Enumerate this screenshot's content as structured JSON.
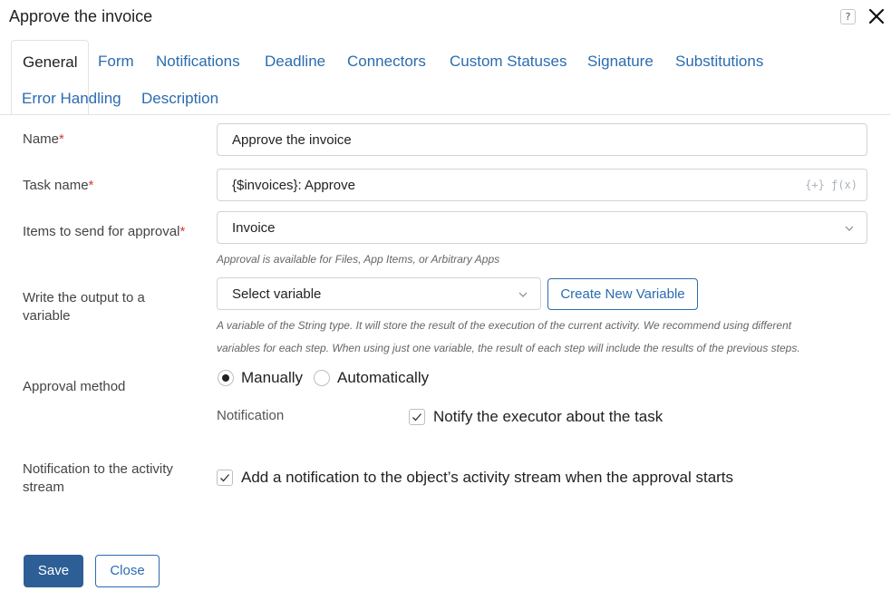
{
  "window": {
    "title": "Approve the invoice",
    "help_glyph": "?"
  },
  "tabs": [
    {
      "label": "General",
      "active": true
    },
    {
      "label": "Form"
    },
    {
      "label": "Notifications"
    },
    {
      "label": "Deadline"
    },
    {
      "label": "Connectors"
    },
    {
      "label": "Custom Statuses"
    },
    {
      "label": "Signature"
    },
    {
      "label": "Substitutions"
    },
    {
      "label": "Error Handling"
    },
    {
      "label": "Description"
    }
  ],
  "form": {
    "name": {
      "label": "Name",
      "required_mark": "*",
      "value": "Approve the invoice"
    },
    "task_name": {
      "label": "Task name",
      "required_mark": "*",
      "value": "{$invoices}: Approve",
      "suffix": "{+} ƒ(x)"
    },
    "items": {
      "label": "Items to send for approval",
      "required_mark": "*",
      "value": "Invoice",
      "hint": "Approval is available for Files, App Items, or Arbitrary Apps"
    },
    "output": {
      "label_line1": "Write the output to a",
      "label_line2": "variable",
      "placeholder": "Select variable",
      "create_button": "Create New Variable",
      "hint_line1": "A variable of the String type. It will store the result of the execution of the current activity. We recommend using different",
      "hint_line2": "variables for each step. When using just one variable, the result of each step will include the results of the previous steps."
    },
    "approval_method": {
      "label": "Approval method",
      "options": [
        {
          "label": "Manually",
          "selected": true
        },
        {
          "label": "Automatically",
          "selected": false
        }
      ],
      "notification_label": "Notification",
      "notify_executor": {
        "label": "Notify the executor about the task",
        "checked": true
      }
    },
    "activity_stream": {
      "label_line1": "Notification to the activity",
      "label_line2": "stream",
      "checkbox": {
        "label": "Add a notification to the object’s activity stream when the approval starts",
        "checked": true
      }
    }
  },
  "footer": {
    "save_label": "Save",
    "close_label": "Close"
  },
  "colors": {
    "accent": "#2b6cb0",
    "primary_button": "#2d5f96",
    "required": "#d23c3c"
  }
}
